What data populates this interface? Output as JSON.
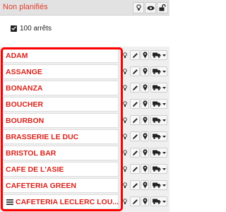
{
  "header": {
    "title": "Non planifiés",
    "icons": [
      "lightbulb-icon",
      "eye-icon",
      "unlock-icon"
    ]
  },
  "summary": {
    "checked": true,
    "count_label": "100 arrêts"
  },
  "stops": [
    {
      "name": "ADAM"
    },
    {
      "name": "ASSANGE"
    },
    {
      "name": "BONANZA"
    },
    {
      "name": "BOUCHER"
    },
    {
      "name": "BOURBON"
    },
    {
      "name": "BRASSERIE LE DUC"
    },
    {
      "name": "BRISTOL BAR"
    },
    {
      "name": "CAFE DE L'ASIE"
    },
    {
      "name": "CAFETERIA GREEN"
    },
    {
      "name": "CAFETERIA LECLERC LOU..."
    }
  ],
  "colors": {
    "accent_text": "#d9231b",
    "highlight_border": "#ff0000",
    "header_bg": "#e2e2e2"
  }
}
